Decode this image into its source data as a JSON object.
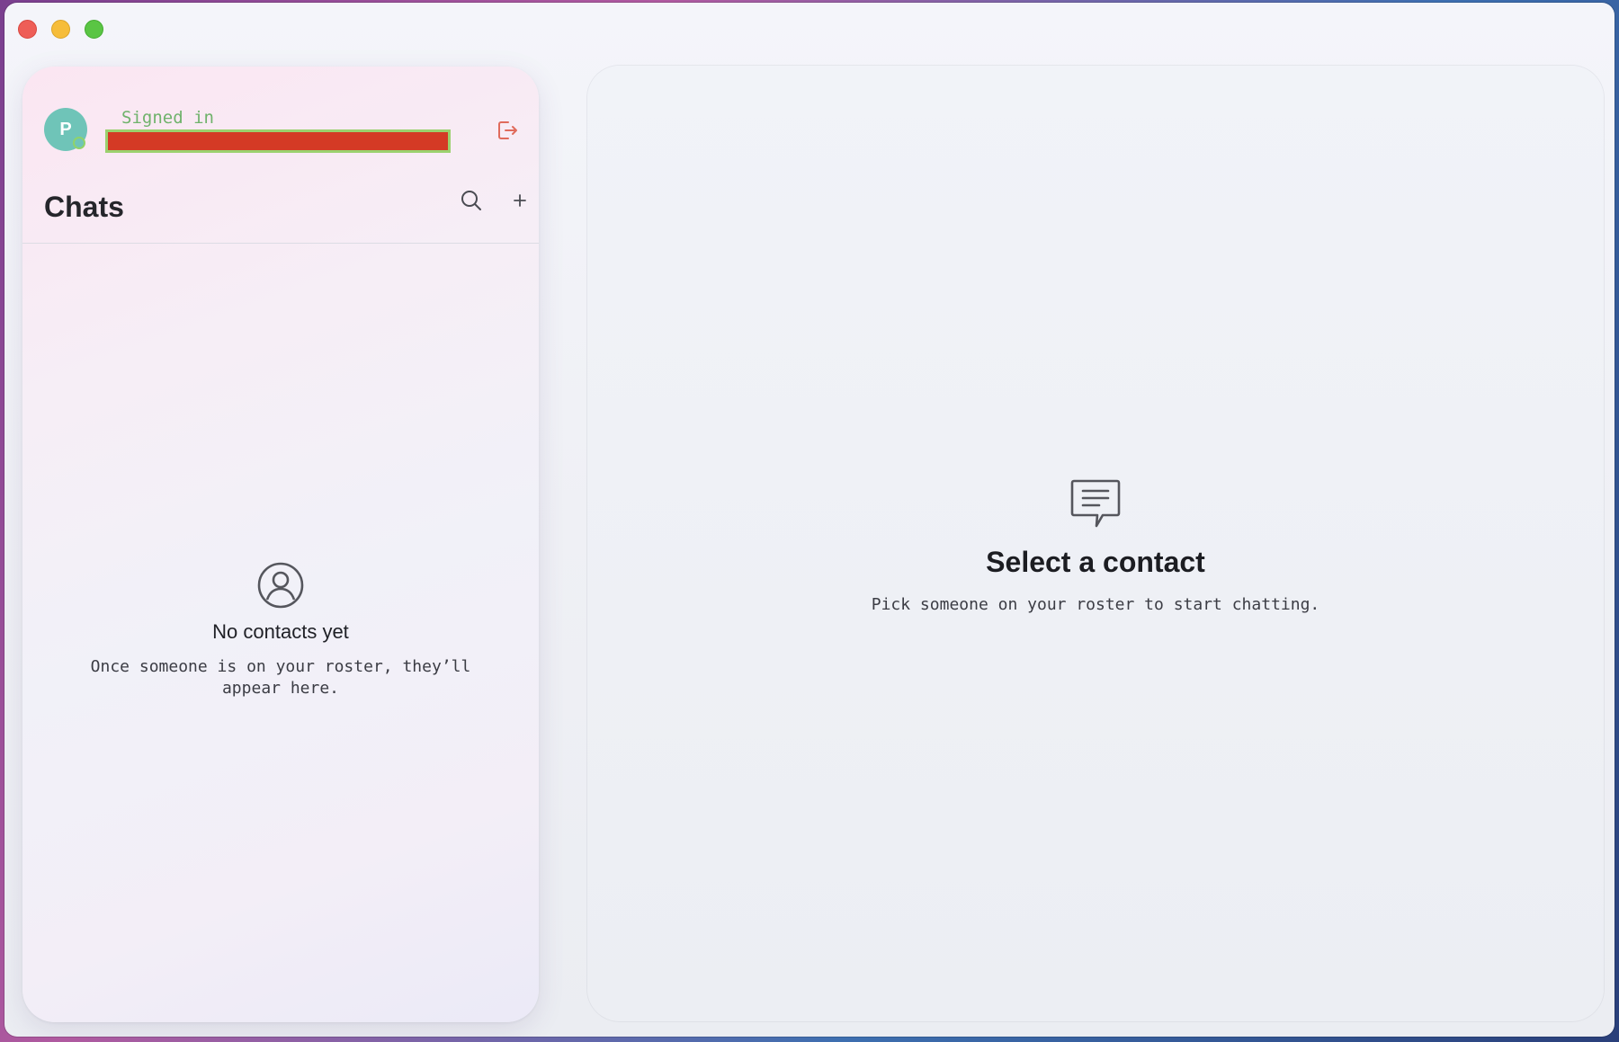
{
  "window": {
    "controls": [
      "close",
      "minimize",
      "zoom"
    ]
  },
  "account": {
    "avatar_initial": "P",
    "signed_in_label": "Signed in",
    "status_color": "#8fd36a",
    "avatar_color": "#6fc4b8",
    "logout_icon": "logout-icon"
  },
  "sidebar": {
    "title": "Chats",
    "search_icon": "search-icon",
    "add_icon": "plus-icon",
    "empty_state": {
      "icon": "person-circle-icon",
      "title": "No contacts yet",
      "description": "Once someone is on your roster, they’ll appear here."
    }
  },
  "main": {
    "empty_state": {
      "icon": "chat-bubble-icon",
      "title": "Select a contact",
      "description": "Pick someone on your roster to start chatting."
    }
  },
  "colors": {
    "accent_logout": "#e06b5c",
    "redaction": "#d43a25"
  }
}
